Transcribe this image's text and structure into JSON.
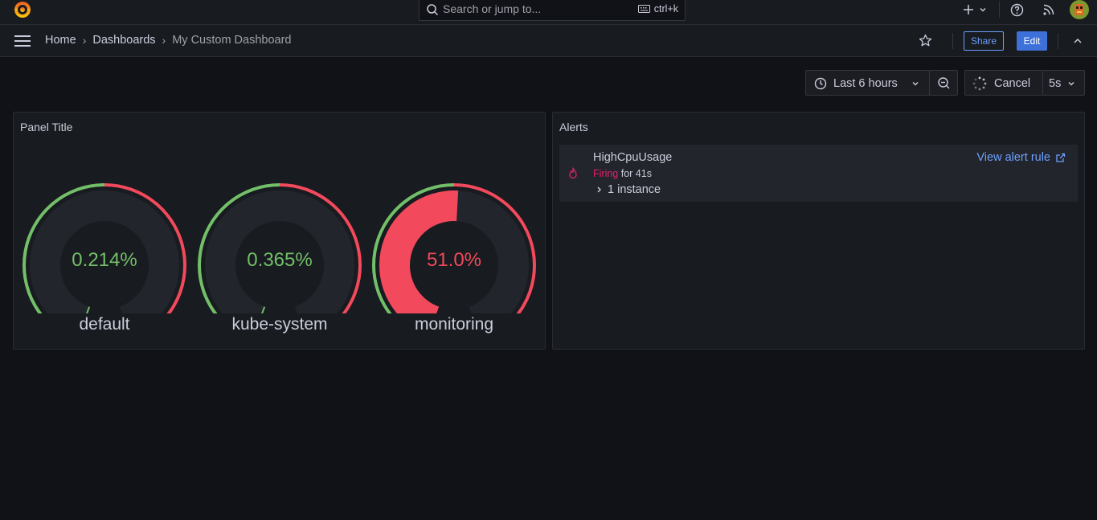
{
  "search": {
    "placeholder": "Search or jump to...",
    "shortcut": "ctrl+k"
  },
  "breadcrumb": {
    "home": "Home",
    "dashboards": "Dashboards",
    "current": "My Custom Dashboard"
  },
  "actions": {
    "share": "Share",
    "edit": "Edit"
  },
  "toolbar": {
    "time_range": "Last 6 hours",
    "cancel": "Cancel",
    "refresh_interval": "5s"
  },
  "gauge_panel": {
    "title": "Panel Title",
    "gauges": [
      {
        "name": "default",
        "display": "0.214%",
        "value": 0.214,
        "color": "#73bf69"
      },
      {
        "name": "kube-system",
        "display": "0.365%",
        "value": 0.365,
        "color": "#73bf69"
      },
      {
        "name": "monitoring",
        "display": "51.0%",
        "value": 51.0,
        "color": "#f2495c"
      }
    ],
    "threshold_percent": 50
  },
  "alerts_panel": {
    "title": "Alerts",
    "alert": {
      "name": "HighCpuUsage",
      "state": "Firing",
      "duration": "for 41s",
      "instances": "1 instance",
      "link": "View alert rule"
    }
  },
  "colors": {
    "green": "#73bf69",
    "red": "#f2495c",
    "blue": "#6e9fff",
    "firing": "#e0226e"
  }
}
